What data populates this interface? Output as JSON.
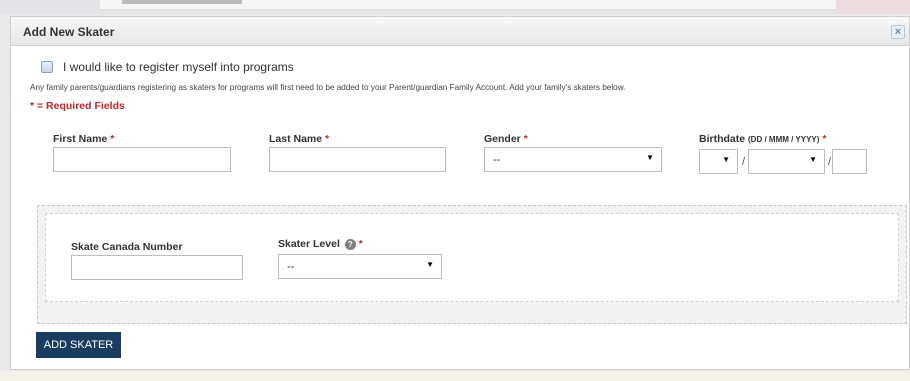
{
  "dialog": {
    "title": "Add New Skater",
    "close_glyph": "×"
  },
  "register": {
    "label": "I would like to register myself into programs"
  },
  "info_text": "Any family parents/guardians registering as skaters for programs will first need to be added to your Parent/guardian Family Account. Add your family's skaters below.",
  "required_note": "* = Required Fields",
  "fields": {
    "first_name": {
      "label": "First Name",
      "star": "*"
    },
    "last_name": {
      "label": "Last Name",
      "star": "*"
    },
    "gender": {
      "label": "Gender",
      "star": "*",
      "value": "--"
    },
    "birthdate": {
      "label": "Birthdate",
      "format": "(DD / MMM / YYYY)",
      "star": "*",
      "separator": "/"
    }
  },
  "skater_section": {
    "skate_canada_label": "Skate Canada Number",
    "skater_level_label": "Skater Level",
    "skater_level_star": "*",
    "skater_level_value": "--",
    "help_glyph": "?"
  },
  "add_button": "ADD SKATER",
  "icons": {
    "close": "close-icon",
    "dropdown": "chevron-down-icon",
    "help": "help-icon"
  },
  "colors": {
    "accent_red": "#c9252b",
    "button_navy": "#193d60"
  }
}
